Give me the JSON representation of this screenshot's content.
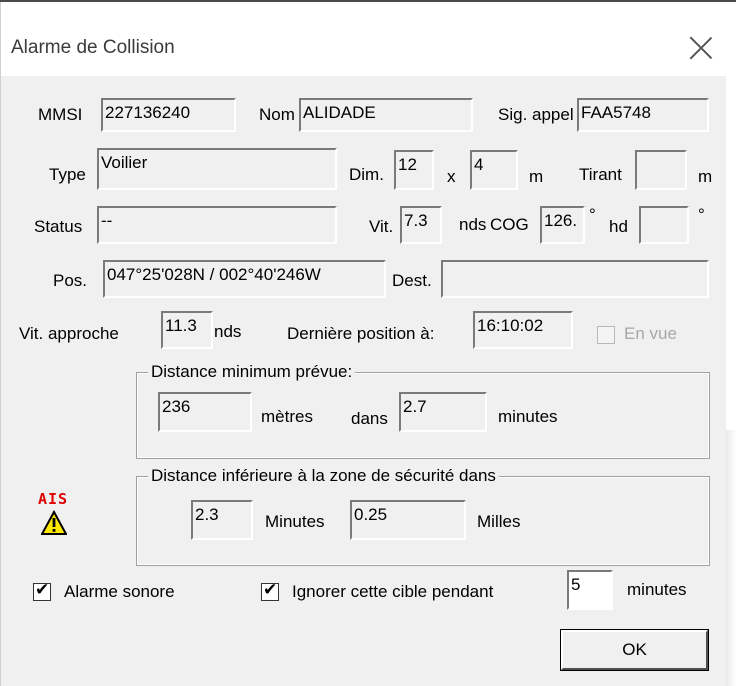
{
  "window": {
    "title": "Alarme de Collision"
  },
  "vessel": {
    "mmsi_label": "MMSI",
    "mmsi": "227136240",
    "nom_label": "Nom",
    "nom": "ALIDADE",
    "sig_label": "Sig. appel",
    "sig": "FAA5748",
    "type_label": "Type",
    "type": "Voilier",
    "dim_label": "Dim.",
    "dim_len": "12",
    "dim_x": "x",
    "dim_wid": "4",
    "dim_unit": "m",
    "tirant_label": "Tirant",
    "tirant": "",
    "tirant_unit": "m",
    "status_label": "Status",
    "status": "--",
    "vit_label": "Vit.",
    "vit": "7.3",
    "nds_label": "nds",
    "cog_label": "COG",
    "cog": "126.",
    "cog_deg": "°",
    "hd_label": "hd",
    "hd": "",
    "hd_deg": "°",
    "pos_label": "Pos.",
    "pos": "047°25'028N / 002°40'246W",
    "dest_label": "Dest.",
    "dest": "",
    "vit_approche_label": "Vit. approche",
    "vit_approche": "11.3",
    "vit_approche_unit": "nds",
    "derniere_label": "Dernière position à:",
    "derniere": "16:10:02",
    "en_vue_label": "En vue"
  },
  "distance_min": {
    "legend": "Distance minimum prévue:",
    "value": "236",
    "metres_label": "mètres",
    "dans_label": "dans",
    "minutes_value": "2.7",
    "minutes_label": "minutes"
  },
  "zone": {
    "legend": "Distance inférieure à la zone de sécurité dans",
    "minutes_value": "2.3",
    "minutes_label": "Minutes",
    "milles_value": "0.25",
    "milles_label": "Milles"
  },
  "ais_icon": {
    "label": "AIS",
    "icon": "warning-triangle-icon",
    "color": "#e00000"
  },
  "footer": {
    "alarme_label": "Alarme sonore",
    "alarme_checked": true,
    "ignorer_label": "Ignorer cette cible pendant",
    "ignorer_checked": true,
    "ignorer_value": "5",
    "ignorer_unit": "minutes",
    "ok_label": "OK"
  }
}
